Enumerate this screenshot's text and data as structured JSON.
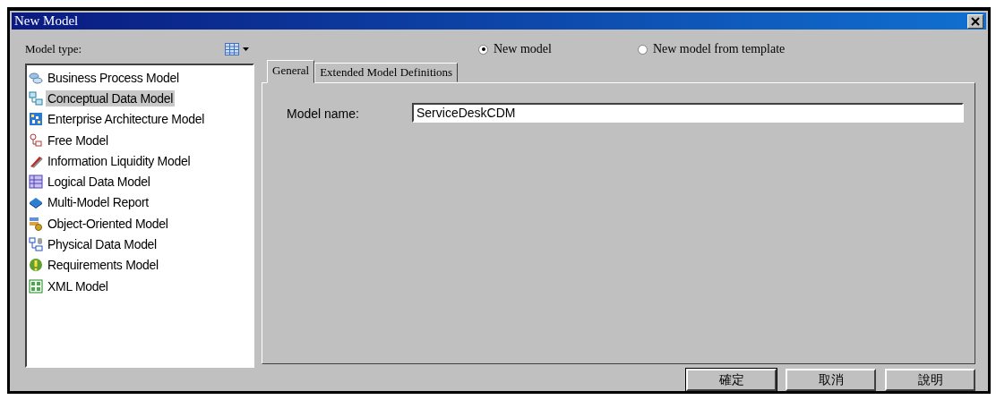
{
  "window": {
    "title": "New Model"
  },
  "model_type": {
    "label": "Model type:",
    "items": [
      {
        "label": "Business Process Model",
        "kind": "process",
        "selected": false
      },
      {
        "label": "Conceptual Data Model",
        "kind": "conceptual",
        "selected": true
      },
      {
        "label": "Enterprise Architecture Model",
        "kind": "enterprise",
        "selected": false
      },
      {
        "label": "Free Model",
        "kind": "free",
        "selected": false
      },
      {
        "label": "Information Liquidity Model",
        "kind": "liquidity",
        "selected": false
      },
      {
        "label": "Logical Data Model",
        "kind": "logical",
        "selected": false
      },
      {
        "label": "Multi-Model Report",
        "kind": "report",
        "selected": false
      },
      {
        "label": "Object-Oriented Model",
        "kind": "object",
        "selected": false
      },
      {
        "label": "Physical Data Model",
        "kind": "physical",
        "selected": false
      },
      {
        "label": "Requirements Model",
        "kind": "requirements",
        "selected": false
      },
      {
        "label": "XML Model",
        "kind": "xml",
        "selected": false
      }
    ]
  },
  "mode": [
    {
      "label": "New model",
      "selected": true
    },
    {
      "label": "New model from template",
      "selected": false
    }
  ],
  "tabs": [
    {
      "label": "General",
      "selected": true
    },
    {
      "label": "Extended Model Definitions",
      "selected": false
    }
  ],
  "model_name": {
    "label": "Model name:",
    "value": "ServiceDeskCDM"
  },
  "buttons": [
    {
      "label": "確定",
      "default": true
    },
    {
      "label": "取消",
      "default": false
    },
    {
      "label": "說明",
      "default": false
    }
  ]
}
